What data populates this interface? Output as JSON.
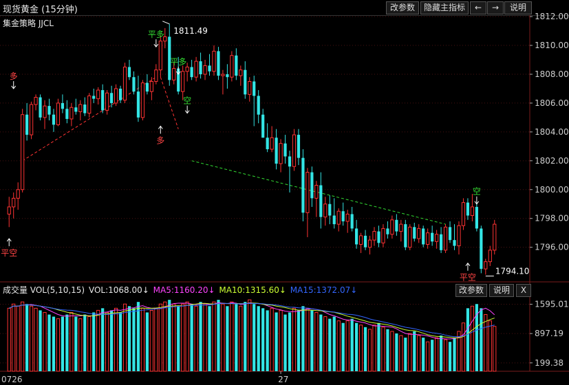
{
  "header": {
    "title": "现货黄金 (15分钟)",
    "buttons": {
      "modify": "改参数",
      "hide_indicator": "隐藏主指标",
      "left": "←",
      "right": "→",
      "explain": "说明"
    }
  },
  "main_chart": {
    "strategy_label": "集金策略 JJCL",
    "high_label": "1811.49",
    "low_label": "1794.10"
  },
  "signals": [
    {
      "text": "多",
      "color": "#ff4444"
    },
    {
      "text": "平空",
      "color": "#ff4444"
    },
    {
      "text": "平多",
      "color": "#33dd33"
    },
    {
      "text": "多",
      "color": "#ff4444"
    },
    {
      "text": "平多",
      "color": "#33dd33"
    },
    {
      "text": "空",
      "color": "#33dd33"
    },
    {
      "text": "空",
      "color": "#33dd33"
    },
    {
      "text": "平空",
      "color": "#ff4444"
    }
  ],
  "volume_panel": {
    "title": "成交量 VOL(5,10,15)",
    "vol": "VOL:1068.00↓",
    "ma5": "MA5:1160.20↓",
    "ma10": "MA10:1315.60↓",
    "ma15": "MA15:1372.07↓",
    "buttons": {
      "modify": "改参数",
      "explain": "说明",
      "close": "X"
    }
  },
  "x_axis_labels": [
    "0726",
    "27"
  ],
  "colors": {
    "up": "#ff3333",
    "down": "#33e5e5",
    "ma5": "#ff44ff",
    "ma10": "#ccff33",
    "ma15": "#3366ff",
    "trend_up": "#ff3333",
    "trend_down": "#33dd33"
  },
  "chart_data": [
    {
      "type": "candlestick",
      "title": "现货黄金 (15分钟)",
      "y_tick_labels": [
        "1812.00",
        "1810.00",
        "1808.00",
        "1806.00",
        "1804.00",
        "1802.00",
        "1800.00",
        "1798.00",
        "1796.00"
      ],
      "ylim": [
        1793.6,
        1812.1
      ],
      "x_tick_labels": [
        "0726",
        "27"
      ],
      "high": 1811.49,
      "low": 1794.1,
      "candles": [
        [
          1798.3,
          1799.5,
          1797.4,
          1798.8
        ],
        [
          1798.8,
          1799.8,
          1798.0,
          1799.4
        ],
        [
          1799.4,
          1800.5,
          1798.6,
          1800.0
        ],
        [
          1800.0,
          1805.6,
          1799.8,
          1805.2
        ],
        [
          1805.2,
          1806.0,
          1803.4,
          1803.8
        ],
        [
          1803.8,
          1806.1,
          1803.5,
          1805.9
        ],
        [
          1805.9,
          1806.6,
          1805.5,
          1806.4
        ],
        [
          1806.4,
          1806.6,
          1804.8,
          1805.0
        ],
        [
          1805.0,
          1806.2,
          1804.2,
          1805.8
        ],
        [
          1805.8,
          1806.3,
          1804.8,
          1805.2
        ],
        [
          1805.2,
          1805.6,
          1804.0,
          1804.5
        ],
        [
          1804.5,
          1806.3,
          1804.4,
          1806.0
        ],
        [
          1806.0,
          1806.6,
          1805.3,
          1805.6
        ],
        [
          1805.6,
          1806.2,
          1804.6,
          1804.9
        ],
        [
          1804.9,
          1806.0,
          1804.4,
          1805.7
        ],
        [
          1805.7,
          1806.3,
          1805.2,
          1805.4
        ],
        [
          1805.4,
          1806.2,
          1804.8,
          1805.9
        ],
        [
          1805.9,
          1806.4,
          1805.1,
          1805.3
        ],
        [
          1805.3,
          1806.7,
          1805.0,
          1806.5
        ],
        [
          1806.5,
          1807.0,
          1806.0,
          1806.3
        ],
        [
          1806.3,
          1807.1,
          1805.9,
          1806.9
        ],
        [
          1806.9,
          1807.3,
          1805.3,
          1805.5
        ],
        [
          1805.5,
          1806.9,
          1805.2,
          1806.7
        ],
        [
          1806.7,
          1807.2,
          1805.7,
          1806.0
        ],
        [
          1806.0,
          1807.3,
          1805.8,
          1807.0
        ],
        [
          1807.0,
          1807.2,
          1806.0,
          1806.2
        ],
        [
          1806.2,
          1808.8,
          1806.0,
          1808.5
        ],
        [
          1808.5,
          1809.0,
          1807.6,
          1807.8
        ],
        [
          1807.8,
          1808.2,
          1806.6,
          1806.8
        ],
        [
          1806.8,
          1807.9,
          1804.7,
          1805.0
        ],
        [
          1805.0,
          1807.6,
          1804.8,
          1807.4
        ],
        [
          1807.4,
          1808.0,
          1806.6,
          1806.8
        ],
        [
          1806.8,
          1807.8,
          1806.2,
          1807.5
        ],
        [
          1807.5,
          1808.7,
          1807.3,
          1808.3
        ],
        [
          1808.3,
          1810.7,
          1807.8,
          1810.3
        ],
        [
          1810.3,
          1811.2,
          1809.8,
          1810.6
        ],
        [
          1810.6,
          1811.5,
          1807.2,
          1807.6
        ],
        [
          1807.6,
          1808.8,
          1807.3,
          1808.4
        ],
        [
          1808.4,
          1809.2,
          1806.6,
          1806.8
        ],
        [
          1806.8,
          1808.6,
          1806.2,
          1808.2
        ],
        [
          1808.2,
          1808.8,
          1807.5,
          1808.5
        ],
        [
          1808.5,
          1809.0,
          1807.6,
          1807.8
        ],
        [
          1807.8,
          1809.2,
          1807.5,
          1808.9
        ],
        [
          1808.9,
          1809.5,
          1807.7,
          1808.0
        ],
        [
          1808.0,
          1809.0,
          1807.6,
          1808.6
        ],
        [
          1808.6,
          1809.4,
          1807.9,
          1808.2
        ],
        [
          1808.2,
          1810.0,
          1807.9,
          1809.6
        ],
        [
          1809.6,
          1809.9,
          1807.6,
          1807.9
        ],
        [
          1807.9,
          1808.3,
          1806.6,
          1808.0
        ],
        [
          1808.0,
          1808.7,
          1807.0,
          1807.8
        ],
        [
          1807.8,
          1809.6,
          1807.5,
          1809.3
        ],
        [
          1809.3,
          1809.8,
          1807.6,
          1807.9
        ],
        [
          1807.9,
          1808.6,
          1807.2,
          1808.3
        ],
        [
          1808.3,
          1808.9,
          1806.3,
          1806.6
        ],
        [
          1806.6,
          1807.8,
          1806.1,
          1807.5
        ],
        [
          1807.5,
          1807.9,
          1804.4,
          1806.5
        ],
        [
          1806.5,
          1806.9,
          1804.6,
          1805.2
        ],
        [
          1805.2,
          1805.6,
          1803.6,
          1803.6
        ],
        [
          1803.6,
          1804.6,
          1802.6,
          1802.8
        ],
        [
          1802.8,
          1804.4,
          1802.6,
          1803.6
        ],
        [
          1803.6,
          1804.2,
          1801.4,
          1801.8
        ],
        [
          1801.8,
          1803.5,
          1801.2,
          1803.2
        ],
        [
          1803.2,
          1803.8,
          1801.8,
          1802.3
        ],
        [
          1802.3,
          1802.7,
          1799.8,
          1801.6
        ],
        [
          1801.6,
          1804.2,
          1801.3,
          1803.8
        ],
        [
          1803.8,
          1804.2,
          1801.7,
          1802.2
        ],
        [
          1802.2,
          1802.8,
          1797.8,
          1798.4
        ],
        [
          1798.4,
          1801.5,
          1796.7,
          1801.2
        ],
        [
          1801.2,
          1801.6,
          1798.8,
          1799.4
        ],
        [
          1799.4,
          1800.6,
          1798.1,
          1800.3
        ],
        [
          1800.3,
          1801.2,
          1797.3,
          1798.1
        ],
        [
          1798.1,
          1799.5,
          1797.5,
          1799.0
        ],
        [
          1799.0,
          1799.6,
          1797.6,
          1798.2
        ],
        [
          1798.2,
          1799.4,
          1797.3,
          1797.6
        ],
        [
          1797.6,
          1798.7,
          1797.1,
          1798.5
        ],
        [
          1798.5,
          1799.1,
          1797.5,
          1797.8
        ],
        [
          1797.8,
          1798.6,
          1797.0,
          1798.3
        ],
        [
          1798.3,
          1798.8,
          1797.1,
          1797.3
        ],
        [
          1797.3,
          1797.9,
          1795.9,
          1796.2
        ],
        [
          1796.2,
          1797.0,
          1795.6,
          1796.8
        ],
        [
          1796.8,
          1797.2,
          1795.8,
          1796.0
        ],
        [
          1796.0,
          1796.8,
          1795.5,
          1796.5
        ],
        [
          1796.5,
          1797.4,
          1796.1,
          1797.1
        ],
        [
          1797.1,
          1797.5,
          1796.0,
          1796.3
        ],
        [
          1796.3,
          1797.6,
          1796.0,
          1797.3
        ],
        [
          1797.3,
          1797.8,
          1796.6,
          1796.9
        ],
        [
          1796.9,
          1798.2,
          1796.6,
          1797.9
        ],
        [
          1797.9,
          1798.3,
          1796.8,
          1797.1
        ],
        [
          1797.1,
          1797.9,
          1796.4,
          1797.6
        ],
        [
          1797.6,
          1797.9,
          1795.8,
          1796.0
        ],
        [
          1796.0,
          1797.6,
          1795.8,
          1797.4
        ],
        [
          1797.4,
          1797.7,
          1796.4,
          1796.6
        ],
        [
          1796.6,
          1797.6,
          1796.3,
          1797.3
        ],
        [
          1797.3,
          1797.5,
          1796.0,
          1796.2
        ],
        [
          1796.2,
          1797.3,
          1795.9,
          1797.0
        ],
        [
          1797.0,
          1797.5,
          1796.1,
          1796.4
        ],
        [
          1796.4,
          1797.2,
          1795.9,
          1796.9
        ],
        [
          1796.9,
          1797.4,
          1795.6,
          1795.8
        ],
        [
          1795.8,
          1797.6,
          1795.6,
          1797.4
        ],
        [
          1797.4,
          1797.8,
          1796.3,
          1796.5
        ],
        [
          1796.5,
          1797.6,
          1795.8,
          1796.1
        ],
        [
          1796.1,
          1797.8,
          1795.5,
          1797.5
        ],
        [
          1797.5,
          1799.4,
          1797.2,
          1799.1
        ],
        [
          1799.1,
          1799.4,
          1797.9,
          1798.2
        ],
        [
          1798.2,
          1799.7,
          1797.8,
          1798.8
        ],
        [
          1798.8,
          1799.2,
          1797.1,
          1797.3
        ],
        [
          1797.3,
          1797.5,
          1794.2,
          1794.5
        ],
        [
          1794.5,
          1795.2,
          1794.1,
          1795.0
        ],
        [
          1795.0,
          1796.1,
          1794.7,
          1795.8
        ],
        [
          1795.8,
          1797.9,
          1795.5,
          1797.6
        ]
      ],
      "volume": {
        "y_tick_labels": [
          "1595.01",
          "897.19",
          "199.38"
        ],
        "ylim": [
          0,
          1800
        ],
        "values": [
          1500,
          1600,
          1550,
          1650,
          1600,
          1550,
          1500,
          1450,
          1400,
          1350,
          1300,
          1250,
          1300,
          1350,
          1400,
          1300,
          1250,
          1350,
          1300,
          1400,
          1450,
          1500,
          1400,
          1450,
          1500,
          1400,
          1600,
          1550,
          1500,
          1650,
          1500,
          1400,
          1450,
          1500,
          1600,
          1650,
          1700,
          1600,
          1550,
          1600,
          1650,
          1600,
          1550,
          1650,
          1600,
          1550,
          1650,
          1700,
          1600,
          1550,
          1650,
          1600,
          1550,
          1650,
          1700,
          1600,
          1550,
          1500,
          1450,
          1500,
          1400,
          1450,
          1350,
          1400,
          1500,
          1450,
          1550,
          1500,
          1450,
          1400,
          1350,
          1300,
          1250,
          1300,
          1200,
          1150,
          1200,
          1250,
          1150,
          1100,
          1050,
          1000,
          1100,
          1150,
          1050,
          1000,
          950,
          900,
          850,
          800,
          900,
          950,
          850,
          800,
          700,
          750,
          800,
          850,
          750,
          700,
          800,
          950,
          1150,
          1500,
          1550,
          1600,
          1500,
          1350,
          1200,
          1068
        ]
      }
    }
  ]
}
